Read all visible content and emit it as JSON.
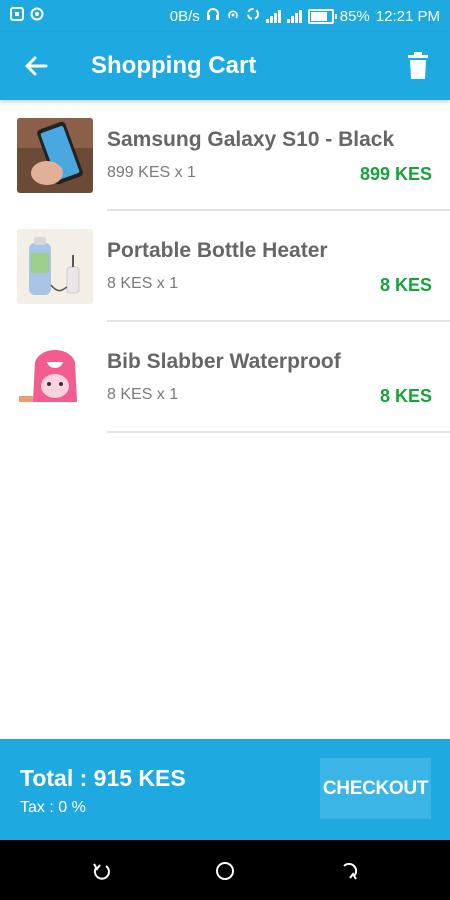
{
  "status_bar": {
    "left_icons": [
      "notification-icon",
      "sync-icon"
    ],
    "net_speed": "0B/s",
    "battery": "85%",
    "time": "12:21 PM"
  },
  "header": {
    "title": "Shopping Cart",
    "back_icon": "arrow-left-icon",
    "delete_icon": "trash-icon"
  },
  "cart": {
    "items": [
      {
        "name": "Samsung Galaxy S10 - Black",
        "qty_line": "899 KES x 1",
        "line_total": "899 KES"
      },
      {
        "name": "Portable Bottle Heater",
        "qty_line": "8 KES x 1",
        "line_total": "8 KES"
      },
      {
        "name": "Bib Slabber Waterproof",
        "qty_line": "8 KES x 1",
        "line_total": "8 KES"
      }
    ]
  },
  "footer": {
    "total": "Total : 915 KES",
    "tax": "Tax : 0 %",
    "checkout_label": "CHECKOUT"
  },
  "navbar": {
    "icons": [
      "back-nav-icon",
      "home-nav-icon",
      "recents-nav-icon"
    ]
  },
  "colors": {
    "primary": "#1ea9e0",
    "price_green": "#18a23a",
    "text_gray": "#666666"
  }
}
